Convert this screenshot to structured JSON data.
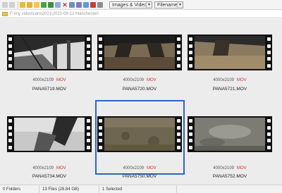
{
  "toolbar": {
    "filter_value": "Images & Videos",
    "sort_value": "Filename"
  },
  "address": {
    "path": "F:\\my video\\cars\\2021\\2021-08-12 Manchester\\"
  },
  "tiles": [
    {
      "dims": "4000x2109",
      "format": "MOV",
      "filename": "PANA5719.MOV"
    },
    {
      "dims": "4000x2109",
      "format": "MOV",
      "filename": "PANA5720.MOV"
    },
    {
      "dims": "4000x2109",
      "format": "MOV",
      "filename": "PANA5721.MOV"
    },
    {
      "dims": "4000x2109",
      "format": "MOV",
      "filename": "PANA5734.MOV"
    },
    {
      "dims": "4000x2109",
      "format": "MOV",
      "filename": "PANA5750.MOV"
    },
    {
      "dims": "4000x2109",
      "format": "MOV",
      "filename": "PANA5752.MOV"
    }
  ],
  "status": {
    "folders": "0 Folders",
    "files": "13 Files (26.84 GB)",
    "selected": "1 Selected"
  }
}
